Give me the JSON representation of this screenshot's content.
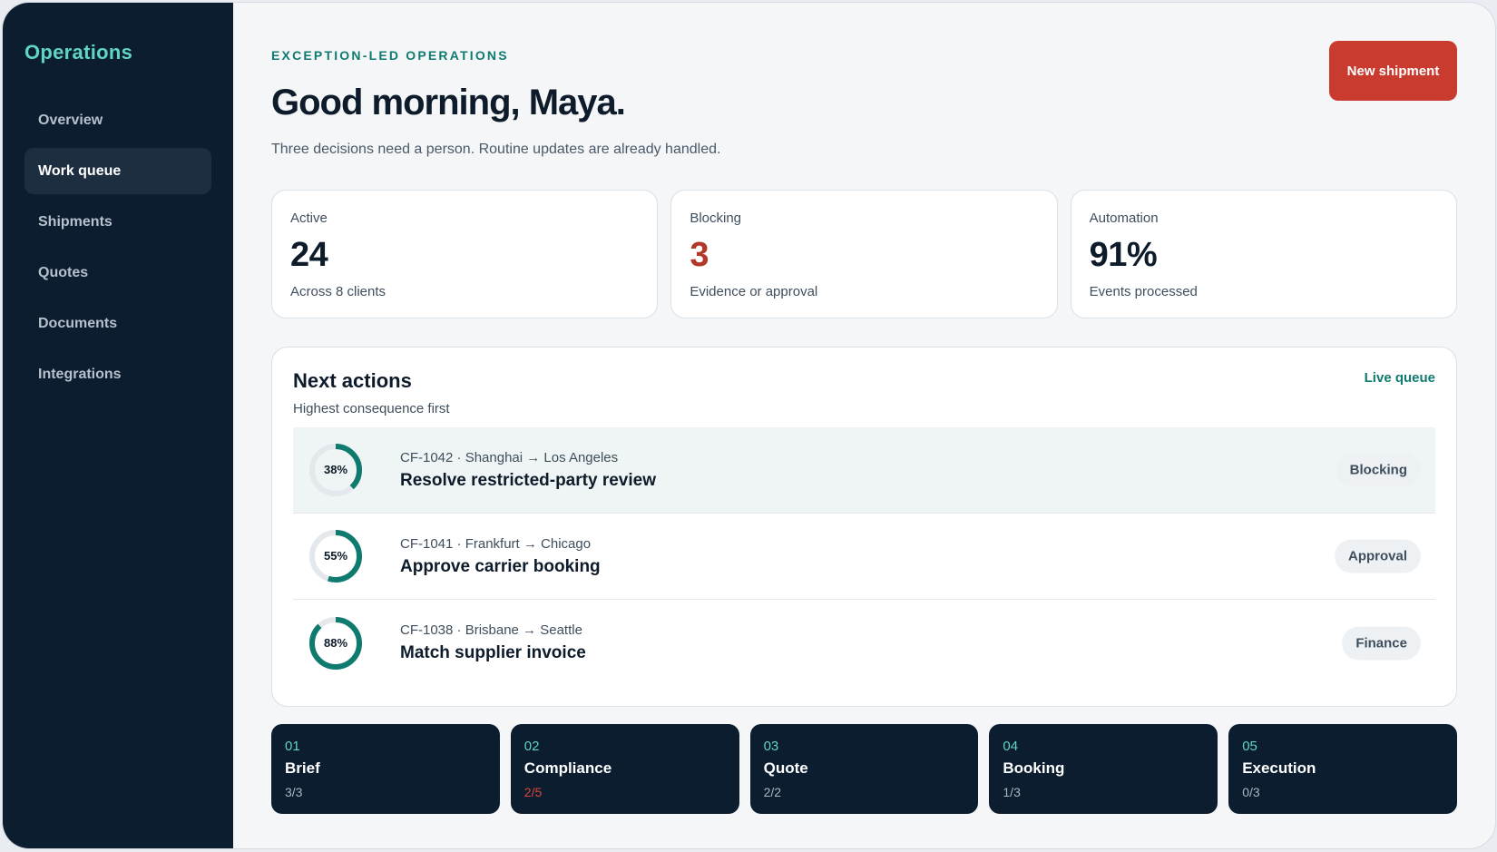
{
  "sidebar": {
    "brand": "Operations",
    "items": [
      {
        "label": "Overview"
      },
      {
        "label": "Work queue",
        "active": true
      },
      {
        "label": "Shipments"
      },
      {
        "label": "Quotes"
      },
      {
        "label": "Documents"
      },
      {
        "label": "Integrations"
      }
    ]
  },
  "header": {
    "eyebrow": "EXCEPTION-LED OPERATIONS",
    "greeting": "Good morning, Maya.",
    "subtitle": "Three decisions need a person. Routine updates are already handled.",
    "primary_button": "New shipment"
  },
  "stats": [
    {
      "label": "Active",
      "value": "24",
      "caption": "Across 8 clients"
    },
    {
      "label": "Blocking",
      "value": "3",
      "caption": "Evidence or approval",
      "color": "#b3382a"
    },
    {
      "label": "Automation",
      "value": "91%",
      "caption": "Events processed"
    }
  ],
  "next_actions": {
    "title": "Next actions",
    "subtitle": "Highest consequence first",
    "link": "Live queue",
    "items": [
      {
        "progress_label": "38%",
        "progress": 0.38,
        "meta": "CF-1042 · Shanghai → Los Angeles",
        "title": "Resolve restricted-party review",
        "tag": "Blocking"
      },
      {
        "progress_label": "55%",
        "progress": 0.55,
        "meta": "CF-1041 · Frankfurt → Chicago",
        "title": "Approve carrier booking",
        "tag": "Approval"
      },
      {
        "progress_label": "88%",
        "progress": 0.88,
        "meta": "CF-1038 · Brisbane → Seattle",
        "title": "Match supplier invoice",
        "tag": "Finance"
      }
    ]
  },
  "stages": [
    {
      "num": "01",
      "name": "Brief",
      "progress": "3/3"
    },
    {
      "num": "02",
      "name": "Compliance",
      "progress": "2/5",
      "alert": true
    },
    {
      "num": "03",
      "name": "Quote",
      "progress": "2/2"
    },
    {
      "num": "04",
      "name": "Booking",
      "progress": "1/3"
    },
    {
      "num": "05",
      "name": "Execution",
      "progress": "0/3"
    }
  ],
  "colors": {
    "accent": "#0f7a6e",
    "brand": "#5fd5c7",
    "danger": "#c93b2e",
    "sidebar_bg": "#0c1d30"
  }
}
